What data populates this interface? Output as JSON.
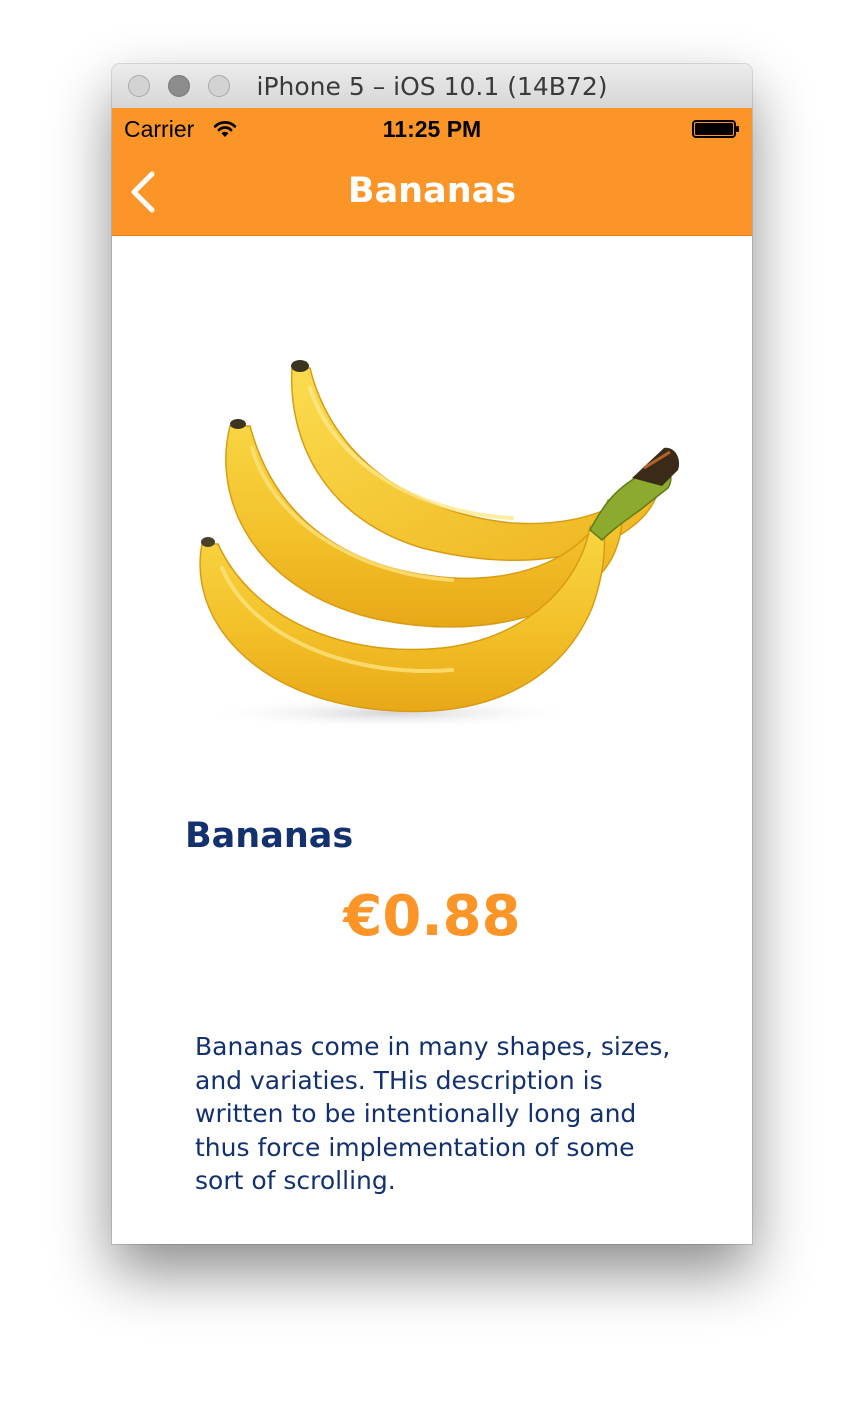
{
  "window": {
    "title": "iPhone 5 – iOS 10.1 (14B72)"
  },
  "status_bar": {
    "carrier": "Carrier",
    "time": "11:25 PM",
    "wifi_icon": "wifi-icon",
    "battery_icon": "battery-icon",
    "battery_level": 1.0
  },
  "nav_bar": {
    "title": "Bananas",
    "back_icon": "chevron-left-icon"
  },
  "product": {
    "image": "bananas-image",
    "name": "Bananas",
    "price": "€0.88",
    "description": "Bananas come in many shapes, sizes, and variaties. THis description is written to be intentionally long and thus force implementation of some sort of scrolling."
  },
  "colors": {
    "accent": "#fb9528",
    "text_primary": "#14316f",
    "background": "#ffffff"
  }
}
